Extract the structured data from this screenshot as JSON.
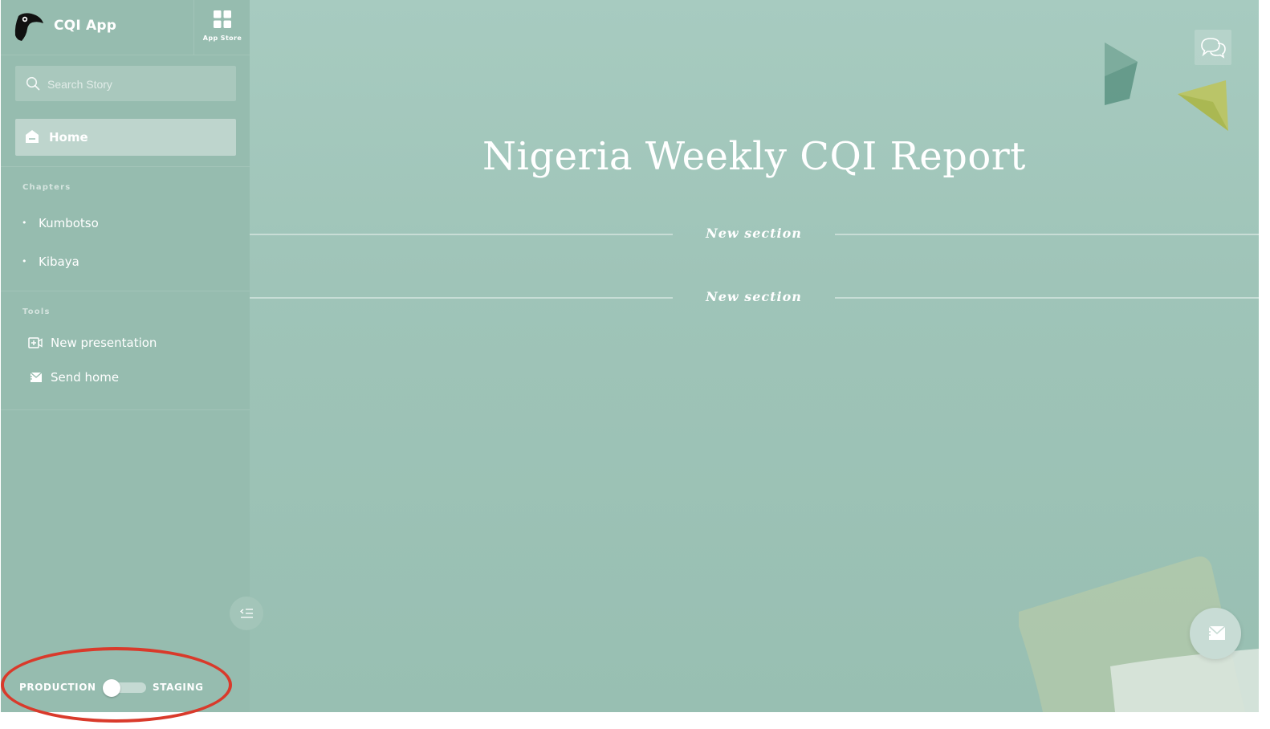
{
  "app": {
    "name": "CQI App"
  },
  "app_store": {
    "label": "App Store"
  },
  "search": {
    "placeholder": "Search Story",
    "value": ""
  },
  "nav": {
    "home_label": "Home"
  },
  "chapters": {
    "heading": "Chapters",
    "items": [
      {
        "label": "Kumbotso"
      },
      {
        "label": "Kibaya"
      }
    ]
  },
  "tools": {
    "heading": "Tools",
    "items": [
      {
        "label": "New presentation",
        "icon": "video-add-icon"
      },
      {
        "label": "Send home",
        "icon": "send-mail-icon"
      }
    ]
  },
  "environment": {
    "left_label": "PRODUCTION",
    "right_label": "STAGING",
    "selected": "PRODUCTION"
  },
  "report": {
    "title": "Nigeria Weekly CQI Report",
    "sections": [
      {
        "title": "New section"
      },
      {
        "title": "New section"
      }
    ]
  },
  "colors": {
    "sidebar": "#96bcaf",
    "main_background": "#9fc4b8",
    "highlight_ring": "#d93a2b"
  }
}
